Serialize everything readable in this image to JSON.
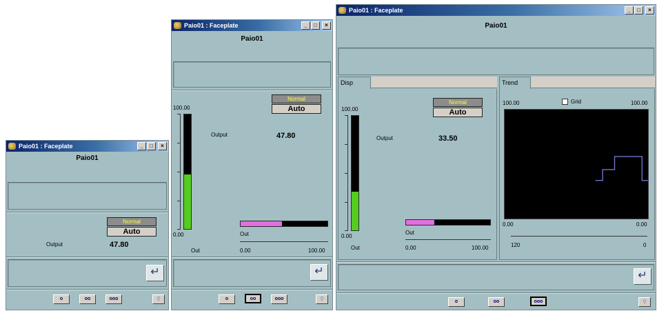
{
  "faceplate": {
    "window_title": "Paio01 : Faceplate",
    "tag_name": "Paio01",
    "mode_status": "Normal",
    "mode": "Auto",
    "output_label": "Output",
    "out_label": "Out",
    "scale_max": "100.00",
    "scale_min": "0.00",
    "enter_glyph": "↵",
    "nav_buttons": [
      "o",
      "oo",
      "ooo"
    ],
    "tool_glyph": "⚲",
    "title_buttons": [
      "_",
      "□",
      "×"
    ]
  },
  "small": {
    "output_value": "47.80",
    "output_fraction": 0.478,
    "active_nav": 0
  },
  "medium": {
    "output_value": "47.80",
    "output_fraction": 0.478,
    "active_nav": 1
  },
  "large": {
    "output_value": "33.50",
    "output_fraction": 0.335,
    "active_nav": 2,
    "tabs": {
      "disp": "Disp",
      "trend": "Trend"
    },
    "trend": {
      "grid_label": "Grid",
      "y_max_left": "100.00",
      "y_max_right": "100.00",
      "y_min_left": "0.00",
      "y_min_right": "0.00",
      "time_left": "120",
      "time_right": "0"
    }
  },
  "chart_data": {
    "type": "line",
    "title": "",
    "xlabel": "",
    "ylabel": "",
    "ylim": [
      0,
      100
    ],
    "xlim": [
      120,
      0
    ],
    "grid": false,
    "series": [
      {
        "x": [
          44,
          38,
          38,
          28,
          28,
          5,
          5,
          0
        ],
        "y": [
          35,
          35,
          45,
          45,
          57,
          57,
          35,
          35
        ]
      }
    ]
  }
}
